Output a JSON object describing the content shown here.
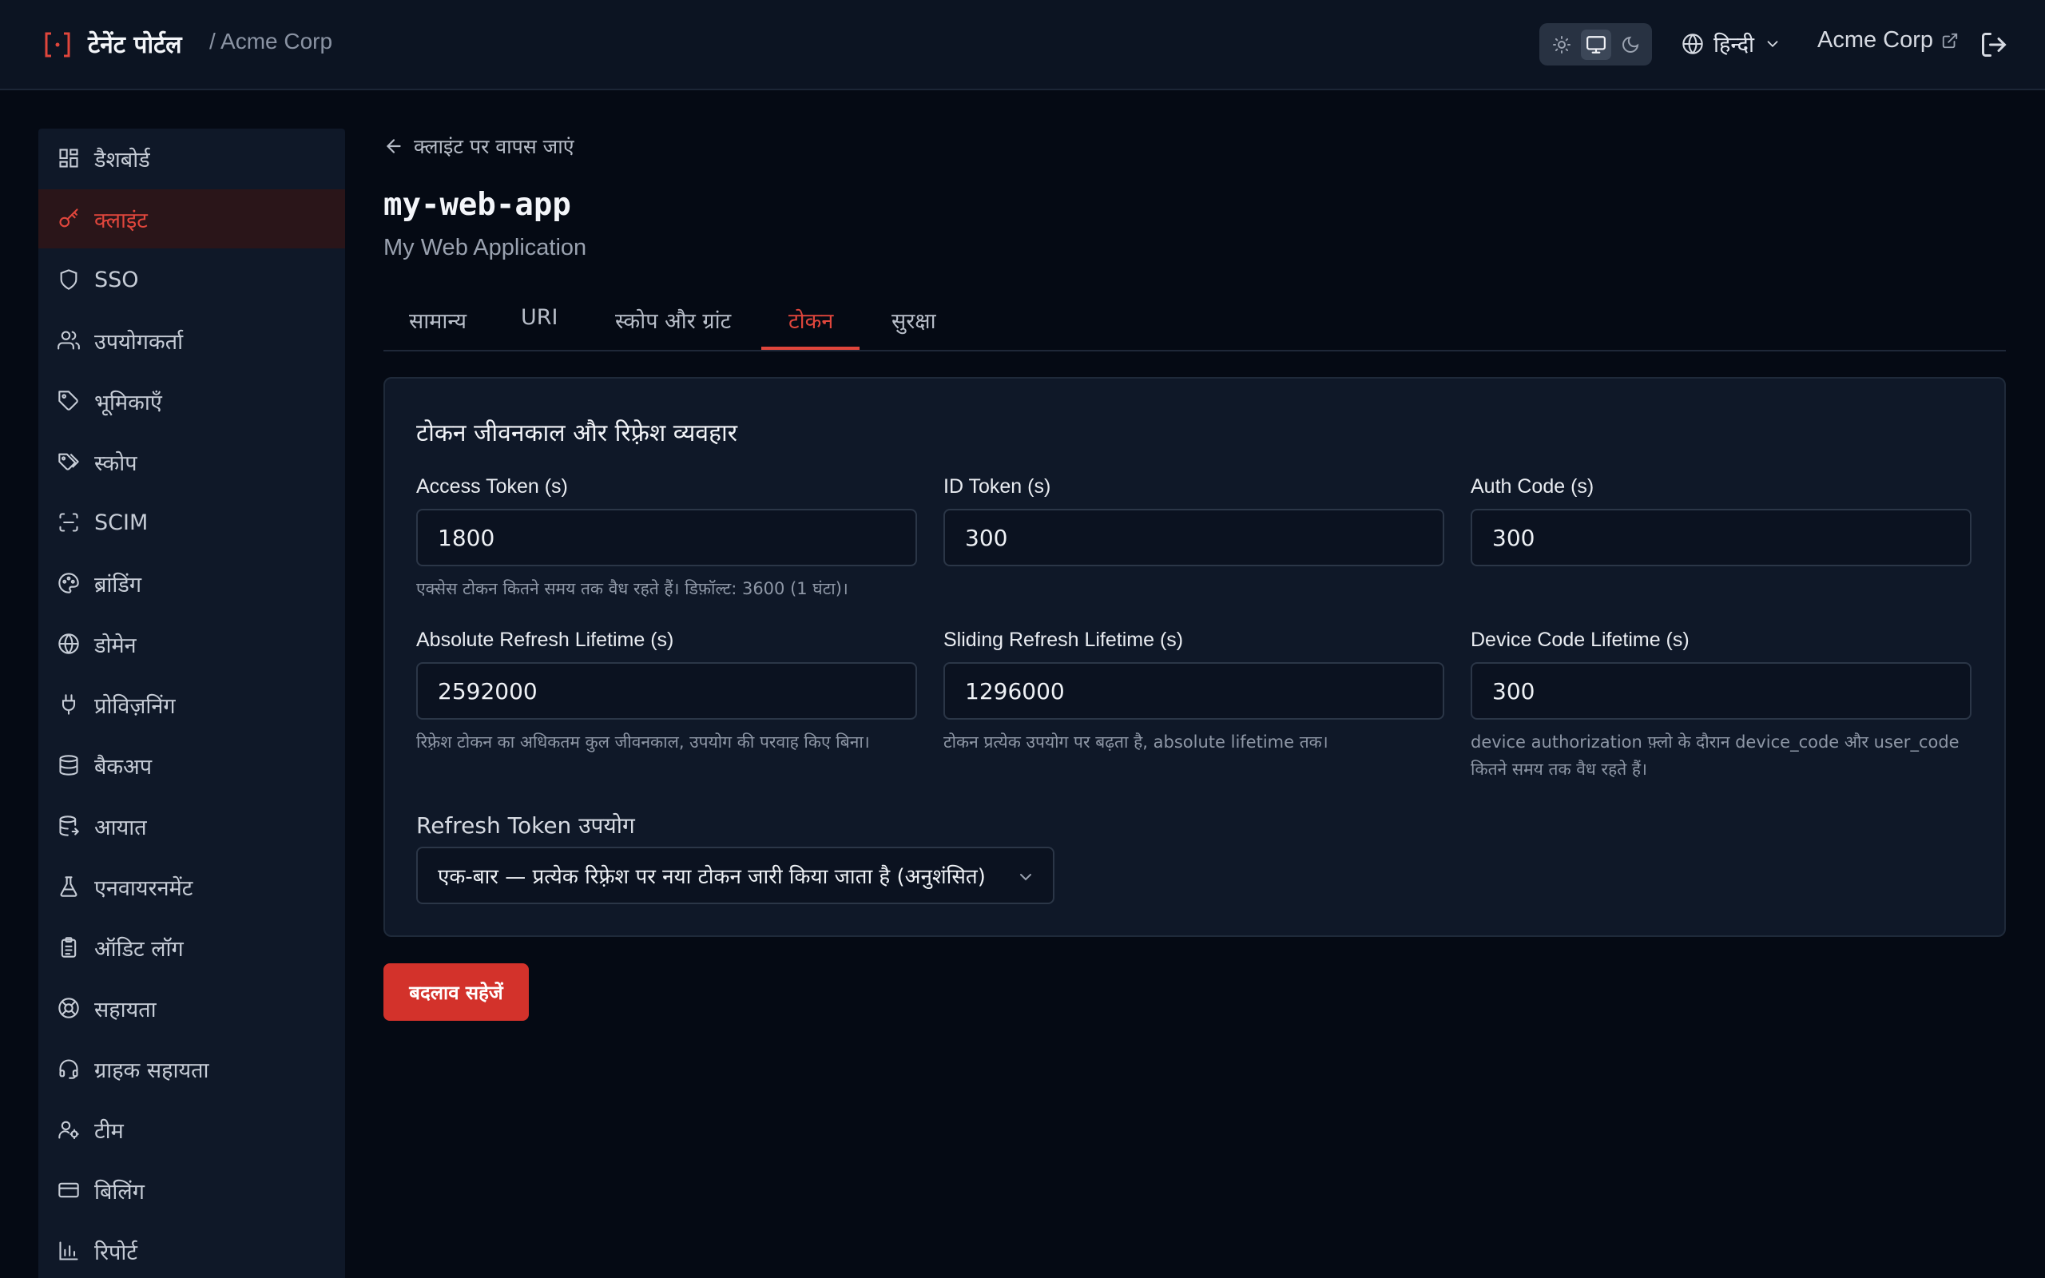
{
  "header": {
    "brand_name": "टेनेंट पोर्टल",
    "breadcrumb": "/ Acme Corp",
    "language": "हिन्दी",
    "tenant_name": "Acme Corp",
    "theme_modes": [
      "sun-icon",
      "monitor-icon",
      "moon-icon"
    ],
    "active_theme": "monitor-icon"
  },
  "sidebar": {
    "items": [
      {
        "label": "डैशबोर्ड",
        "icon": "dashboard-icon"
      },
      {
        "label": "क्लाइंट",
        "icon": "key-icon",
        "active": true
      },
      {
        "label": "SSO",
        "icon": "shield-icon"
      },
      {
        "label": "उपयोगकर्ता",
        "icon": "users-icon"
      },
      {
        "label": "भूमिकाएँ",
        "icon": "tag-icon"
      },
      {
        "label": "स्कोप",
        "icon": "tags-icon"
      },
      {
        "label": "SCIM",
        "icon": "scan-icon"
      },
      {
        "label": "ब्रांडिंग",
        "icon": "palette-icon"
      },
      {
        "label": "डोमेन",
        "icon": "globe-icon"
      },
      {
        "label": "प्रोविज़निंग",
        "icon": "plug-icon"
      },
      {
        "label": "बैकअप",
        "icon": "database-icon"
      },
      {
        "label": "आयात",
        "icon": "database-import-icon"
      },
      {
        "label": "एनवायरनमेंट",
        "icon": "flask-icon"
      },
      {
        "label": "ऑडिट लॉग",
        "icon": "clipboard-icon"
      },
      {
        "label": "सहायता",
        "icon": "lifebuoy-icon"
      },
      {
        "label": "ग्राहक सहायता",
        "icon": "headset-icon"
      },
      {
        "label": "टीम",
        "icon": "user-cog-icon"
      },
      {
        "label": "बिलिंग",
        "icon": "credit-card-icon"
      },
      {
        "label": "रिपोर्ट",
        "icon": "chart-icon"
      }
    ]
  },
  "main": {
    "back_link": "क्लाइंट पर वापस जाएं",
    "client_id": "my-web-app",
    "client_name": "My Web Application",
    "tabs": [
      {
        "label": "सामान्य"
      },
      {
        "label": "URI"
      },
      {
        "label": "स्कोप और ग्रांट"
      },
      {
        "label": "टोकन",
        "active": true
      },
      {
        "label": "सुरक्षा"
      }
    ],
    "card_title": "टोकन जीवनकाल और रिफ़्रेश व्यवहार",
    "fields": [
      {
        "label": "Access Token (s)",
        "value": "1800",
        "help": "एक्सेस टोकन कितने समय तक वैध रहते हैं। डिफ़ॉल्ट: 3600 (1 घंटा)।"
      },
      {
        "label": "ID Token (s)",
        "value": "300",
        "help": ""
      },
      {
        "label": "Auth Code (s)",
        "value": "300",
        "help": ""
      },
      {
        "label": "Absolute Refresh Lifetime (s)",
        "value": "2592000",
        "help": "रिफ़्रेश टोकन का अधिकतम कुल जीवनकाल, उपयोग की परवाह किए बिना।"
      },
      {
        "label": "Sliding Refresh Lifetime (s)",
        "value": "1296000",
        "help": "टोकन प्रत्येक उपयोग पर बढ़ता है, absolute lifetime तक।"
      },
      {
        "label": "Device Code Lifetime (s)",
        "value": "300",
        "help_line1": "device authorization फ़्लो के दौरान device_code और user_code",
        "help_line2": "कितने समय तक वैध रहते हैं।"
      }
    ],
    "refresh_usage_label": "Refresh Token उपयोग",
    "refresh_usage_value": "एक-बार — प्रत्येक रिफ़्रेश पर नया टोकन जारी किया जाता है (अनुशंसित)",
    "save_label": "बदलाव सहेजें"
  },
  "colors": {
    "accent": "#e0463c",
    "button": "#d3322b",
    "background": "#050a14",
    "panel": "#0f1828"
  }
}
